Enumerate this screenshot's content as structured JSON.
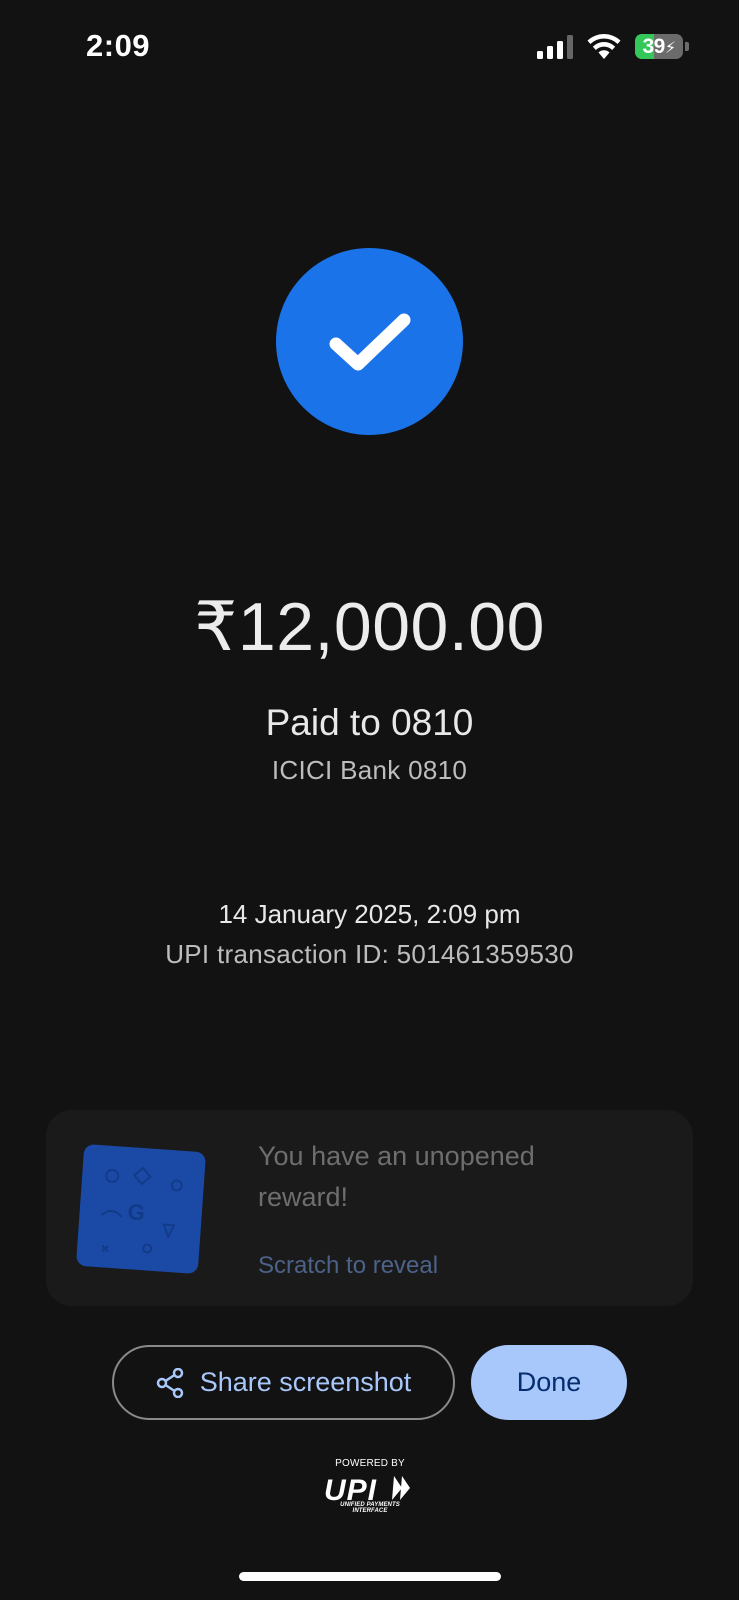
{
  "status_bar": {
    "time": "2:09",
    "battery_level": "39",
    "battery_fraction": 0.39,
    "battery_color": "#34c759"
  },
  "success": {
    "icon": "check-icon",
    "color": "#1a73e8"
  },
  "payment": {
    "amount": "₹12,000.00",
    "paid_to": "Paid to 0810",
    "bank": "ICICI Bank 0810",
    "datetime": "14 January 2025, 2:09 pm",
    "transaction_id": "UPI transaction ID: 501461359530"
  },
  "reward": {
    "title": "You have an unopened reward!",
    "cta": "Scratch to reveal",
    "icon": "scratch-card-icon"
  },
  "actions": {
    "share_label": "Share screenshot",
    "share_icon": "share-icon",
    "done_label": "Done"
  },
  "footer": {
    "powered_by": "POWERED BY",
    "brand": "UPI",
    "tagline": "UNIFIED PAYMENTS INTERFACE"
  }
}
